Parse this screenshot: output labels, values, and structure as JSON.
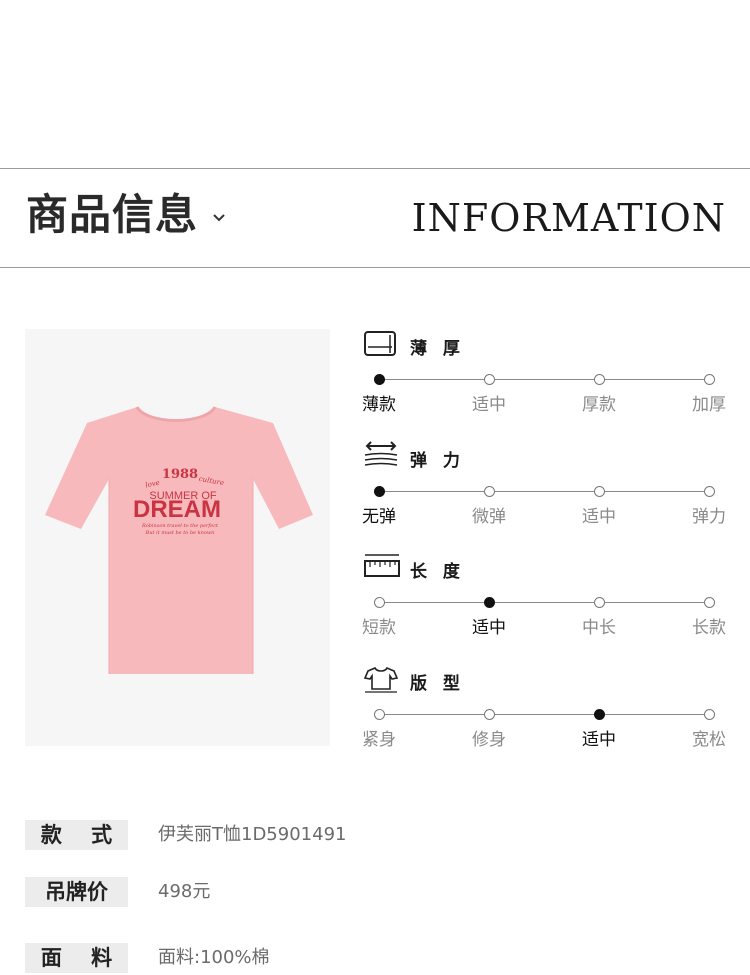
{
  "header": {
    "title_cn": "商品信息",
    "title_en": "INFORMATION",
    "chevron_icon": "chevron-down-icon"
  },
  "product": {
    "image_name": "pink-tshirt",
    "tshirt_color": "#f8b9bd",
    "print_color": "#c83442",
    "print": {
      "line1": "1988",
      "left_script": "love",
      "right_script": "culture",
      "line2": "SUMMER OF",
      "line3": "DREAM",
      "script1": "Robinson travel to the perfect",
      "script2": "But it must be to be known"
    }
  },
  "attributes": [
    {
      "title": "薄 厚",
      "icon": "fabric-thickness-icon",
      "options": [
        "薄款",
        "适中",
        "厚款",
        "加厚"
      ],
      "selected": 0
    },
    {
      "title": "弹 力",
      "icon": "stretch-icon",
      "options": [
        "无弹",
        "微弹",
        "适中",
        "弹力"
      ],
      "selected": 0
    },
    {
      "title": "长 度",
      "icon": "ruler-icon",
      "options": [
        "短款",
        "适中",
        "中长",
        "长款"
      ],
      "selected": 1
    },
    {
      "title": "版 型",
      "icon": "tshirt-fit-icon",
      "options": [
        "紧身",
        "修身",
        "适中",
        "宽松"
      ],
      "selected": 2
    }
  ],
  "specs": [
    {
      "label": "款    式",
      "value": "伊芙丽T恤1D5901491"
    },
    {
      "label": "吊牌价",
      "value": "498元"
    },
    {
      "label": "面    料",
      "value": "面料:100%棉"
    }
  ]
}
